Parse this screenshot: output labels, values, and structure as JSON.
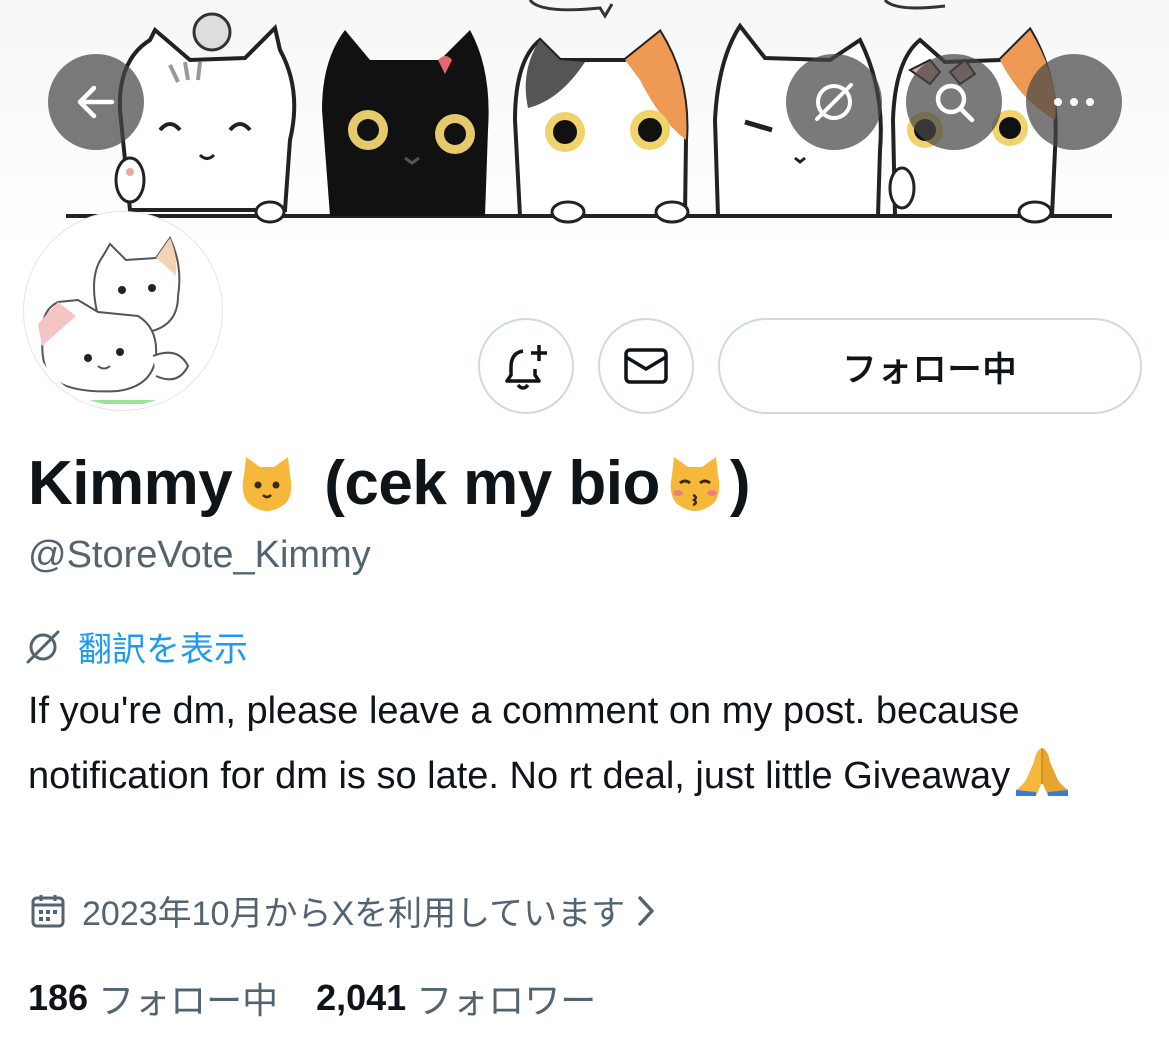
{
  "profile": {
    "display_name": "Kimmy",
    "display_name_suffix": "(cek my bio",
    "display_name_close": ")",
    "handle": "@StoreVote_Kimmy",
    "translate_label": "翻訳を表示",
    "bio_text": "If you're dm, please leave a comment on my post. because notification for dm is so late. No rt deal, just little Giveaway",
    "joined": "2023年10月からXを利用しています",
    "following_count": "186",
    "following_label": "フォロー中",
    "followers_count": "2,041",
    "followers_label": "フォロワー"
  },
  "actions": {
    "follow_label": "フォロー中"
  },
  "icons": {
    "back": "arrow-left-icon",
    "translate": "globe-slash-icon",
    "search": "search-icon",
    "more": "more-icon",
    "notify": "bell-plus-icon",
    "message": "envelope-icon",
    "calendar": "calendar-icon",
    "chevron": "chevron-right-icon",
    "emoji_cat": "cat-face-emoji",
    "emoji_kissing_cat": "kissing-cat-emoji",
    "emoji_pray": "folded-hands-emoji"
  },
  "colors": {
    "link": "#1d9bf0",
    "secondary_text": "#536471",
    "border": "#cfd9de",
    "overlay_button": "#464646"
  }
}
